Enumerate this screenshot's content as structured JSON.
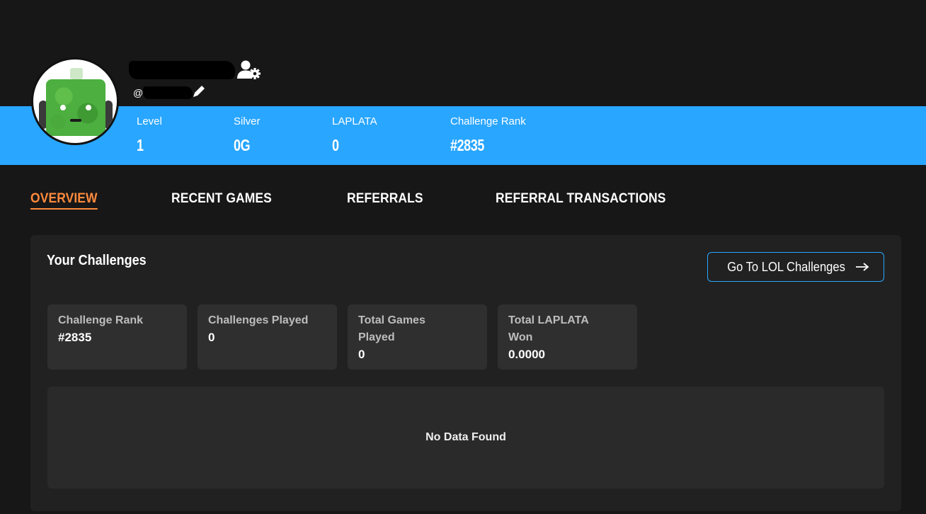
{
  "profile": {
    "handle_prefix": "@",
    "avatar_icon": "robot-avatar"
  },
  "stats": [
    {
      "label": "Level",
      "value": "1"
    },
    {
      "label": "Silver",
      "value": "0G"
    },
    {
      "label": "LAPLATA",
      "value": "0"
    },
    {
      "label": "Challenge Rank",
      "value": "#2835"
    }
  ],
  "tabs": [
    {
      "label": "OVERVIEW",
      "active": true
    },
    {
      "label": "RECENT GAMES",
      "active": false
    },
    {
      "label": "REFERRALS",
      "active": false
    },
    {
      "label": "REFERRAL TRANSACTIONS",
      "active": false
    }
  ],
  "challenges": {
    "title": "Your Challenges",
    "go_button_label": "Go To LOL Challenges",
    "go_button_icon": "arrow-right-icon",
    "cards": [
      {
        "label": "Challenge Rank",
        "value": "#2835"
      },
      {
        "label": "Challenges Played",
        "value": "0"
      },
      {
        "label": "Total Games Played",
        "value": "0"
      },
      {
        "label": "Total LAPLATA Won",
        "value": "0.0000"
      }
    ],
    "empty_text": "No Data Found"
  },
  "colors": {
    "accent_blue": "#29a6ff",
    "active_tab": "#ff8a3d",
    "background": "#171717",
    "panel": "#212121",
    "card": "#2f2f2f"
  }
}
